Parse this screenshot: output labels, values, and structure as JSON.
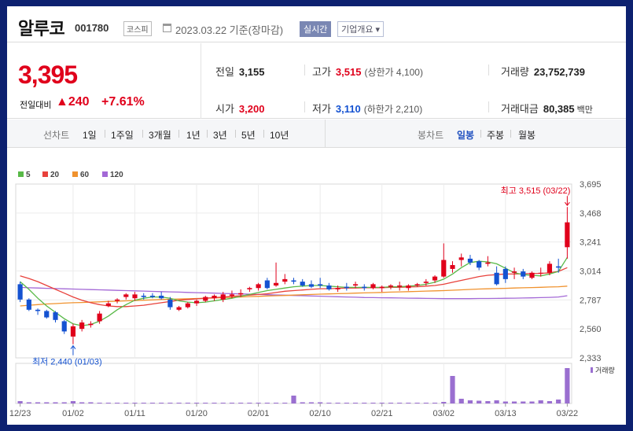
{
  "header": {
    "name": "알루코",
    "code": "001780",
    "market": "코스피",
    "date": "2023.03.22 기준(장마감)",
    "realtime": "실시간",
    "company_info": "기업개요 ▾"
  },
  "quote": {
    "price": "3,395",
    "change_label": "전일대비",
    "change": "▲240",
    "change_pct": "+7.61%",
    "prev_close_label": "전일",
    "prev_close": "3,155",
    "high_label": "고가",
    "high": "3,515",
    "upper_limit": "(상한가 4,100)",
    "volume_label": "거래량",
    "volume": "23,752,739",
    "open_label": "시가",
    "open": "3,200",
    "low_label": "저가",
    "low": "3,110",
    "lower_limit": "(하한가 2,210)",
    "amount_label": "거래대금",
    "amount": "80,385",
    "amount_unit": "백만"
  },
  "period_bar": {
    "line_label": "선차트",
    "line_periods": [
      "1일",
      "1주일",
      "3개월",
      "1년",
      "3년",
      "5년",
      "10년"
    ],
    "candle_label": "봉차트",
    "candle_periods": [
      "일봉",
      "주봉",
      "월봉"
    ],
    "active_candle": "일봉"
  },
  "colors": {
    "up": "#e0001b",
    "down": "#1452d1",
    "ma5": "#58b947",
    "ma20": "#e8413b",
    "ma60": "#f0922e",
    "ma120": "#a368d6",
    "volume": "#9a6fd0"
  },
  "chart_data": {
    "type": "candlestick",
    "legend": [
      {
        "name": "5",
        "color": "#58b947"
      },
      {
        "name": "20",
        "color": "#e8413b"
      },
      {
        "name": "60",
        "color": "#f0922e"
      },
      {
        "name": "120",
        "color": "#a368d6"
      }
    ],
    "y_ticks": [
      "3,695",
      "3,468",
      "3,241",
      "3,014",
      "2,787",
      "2,560",
      "2,333"
    ],
    "ylim": [
      2333,
      3695
    ],
    "x_ticks": [
      "12/23",
      "01/02",
      "01/11",
      "01/20",
      "02/01",
      "02/10",
      "02/21",
      "03/02",
      "03/13",
      "03/22"
    ],
    "x_tick_index": [
      0,
      6,
      13,
      20,
      27,
      34,
      41,
      48,
      55,
      62
    ],
    "high_annotation": "최고 3,515 (03/22)",
    "low_annotation": "최저 2,440 (01/03)",
    "volume_label": "거래량",
    "candles": [
      {
        "o": 2910,
        "h": 2930,
        "l": 2770,
        "c": 2790
      },
      {
        "o": 2790,
        "h": 2800,
        "l": 2700,
        "c": 2710
      },
      {
        "o": 2710,
        "h": 2720,
        "l": 2670,
        "c": 2700
      },
      {
        "o": 2700,
        "h": 2710,
        "l": 2640,
        "c": 2650
      },
      {
        "o": 2690,
        "h": 2700,
        "l": 2610,
        "c": 2630
      },
      {
        "o": 2620,
        "h": 2630,
        "l": 2520,
        "c": 2540
      },
      {
        "o": 2500,
        "h": 2600,
        "l": 2440,
        "c": 2580
      },
      {
        "o": 2560,
        "h": 2630,
        "l": 2540,
        "c": 2610
      },
      {
        "o": 2590,
        "h": 2620,
        "l": 2570,
        "c": 2600
      },
      {
        "o": 2620,
        "h": 2700,
        "l": 2600,
        "c": 2680
      },
      {
        "o": 2740,
        "h": 2780,
        "l": 2730,
        "c": 2760
      },
      {
        "o": 2780,
        "h": 2800,
        "l": 2760,
        "c": 2790
      },
      {
        "o": 2810,
        "h": 2840,
        "l": 2790,
        "c": 2830
      },
      {
        "o": 2800,
        "h": 2850,
        "l": 2780,
        "c": 2830
      },
      {
        "o": 2820,
        "h": 2840,
        "l": 2790,
        "c": 2810
      },
      {
        "o": 2820,
        "h": 2840,
        "l": 2800,
        "c": 2810
      },
      {
        "o": 2820,
        "h": 2850,
        "l": 2790,
        "c": 2800
      },
      {
        "o": 2790,
        "h": 2810,
        "l": 2710,
        "c": 2730
      },
      {
        "o": 2710,
        "h": 2740,
        "l": 2700,
        "c": 2730
      },
      {
        "o": 2730,
        "h": 2770,
        "l": 2720,
        "c": 2760
      },
      {
        "o": 2760,
        "h": 2790,
        "l": 2740,
        "c": 2780
      },
      {
        "o": 2780,
        "h": 2820,
        "l": 2770,
        "c": 2810
      },
      {
        "o": 2800,
        "h": 2830,
        "l": 2780,
        "c": 2820
      },
      {
        "o": 2790,
        "h": 2850,
        "l": 2770,
        "c": 2830
      },
      {
        "o": 2820,
        "h": 2860,
        "l": 2800,
        "c": 2830
      },
      {
        "o": 2830,
        "h": 2870,
        "l": 2810,
        "c": 2840
      },
      {
        "o": 2870,
        "h": 2890,
        "l": 2850,
        "c": 2880
      },
      {
        "o": 2880,
        "h": 2920,
        "l": 2860,
        "c": 2910
      },
      {
        "o": 2940,
        "h": 2960,
        "l": 2870,
        "c": 2880
      },
      {
        "o": 2900,
        "h": 3080,
        "l": 2890,
        "c": 2920
      },
      {
        "o": 2930,
        "h": 2990,
        "l": 2910,
        "c": 2950
      },
      {
        "o": 2940,
        "h": 2960,
        "l": 2910,
        "c": 2930
      },
      {
        "o": 2930,
        "h": 2950,
        "l": 2890,
        "c": 2900
      },
      {
        "o": 2910,
        "h": 2940,
        "l": 2880,
        "c": 2890
      },
      {
        "o": 2910,
        "h": 2960,
        "l": 2880,
        "c": 2900
      },
      {
        "o": 2900,
        "h": 2920,
        "l": 2860,
        "c": 2870
      },
      {
        "o": 2870,
        "h": 2900,
        "l": 2850,
        "c": 2880
      },
      {
        "o": 2890,
        "h": 2920,
        "l": 2860,
        "c": 2880
      },
      {
        "o": 2900,
        "h": 2930,
        "l": 2880,
        "c": 2910
      },
      {
        "o": 2890,
        "h": 2910,
        "l": 2860,
        "c": 2880
      },
      {
        "o": 2880,
        "h": 2920,
        "l": 2870,
        "c": 2910
      },
      {
        "o": 2880,
        "h": 2900,
        "l": 2850,
        "c": 2890
      },
      {
        "o": 2890,
        "h": 2910,
        "l": 2870,
        "c": 2900
      },
      {
        "o": 2890,
        "h": 2930,
        "l": 2860,
        "c": 2900
      },
      {
        "o": 2880,
        "h": 2910,
        "l": 2860,
        "c": 2900
      },
      {
        "o": 2900,
        "h": 2920,
        "l": 2890,
        "c": 2910
      },
      {
        "o": 2920,
        "h": 2950,
        "l": 2900,
        "c": 2930
      },
      {
        "o": 2940,
        "h": 2980,
        "l": 2920,
        "c": 2970
      },
      {
        "o": 2970,
        "h": 3230,
        "l": 2960,
        "c": 3100
      },
      {
        "o": 3030,
        "h": 3090,
        "l": 3000,
        "c": 3060
      },
      {
        "o": 3100,
        "h": 3150,
        "l": 3050,
        "c": 3120
      },
      {
        "o": 3110,
        "h": 3140,
        "l": 3060,
        "c": 3080
      },
      {
        "o": 3090,
        "h": 3100,
        "l": 3020,
        "c": 3040
      },
      {
        "o": 3070,
        "h": 3130,
        "l": 3050,
        "c": 3080
      },
      {
        "o": 3000,
        "h": 3050,
        "l": 2900,
        "c": 2910
      },
      {
        "o": 3030,
        "h": 3050,
        "l": 2920,
        "c": 2950
      },
      {
        "o": 3000,
        "h": 3040,
        "l": 2950,
        "c": 3010
      },
      {
        "o": 3010,
        "h": 3030,
        "l": 2950,
        "c": 2970
      },
      {
        "o": 2960,
        "h": 3010,
        "l": 2950,
        "c": 3000
      },
      {
        "o": 3000,
        "h": 3040,
        "l": 2970,
        "c": 3000
      },
      {
        "o": 3000,
        "h": 3090,
        "l": 2980,
        "c": 3070
      },
      {
        "o": 3050,
        "h": 3110,
        "l": 3000,
        "c": 3040
      },
      {
        "o": 3200,
        "h": 3515,
        "l": 3110,
        "c": 3395
      }
    ],
    "ma5": [
      2930,
      2870,
      2800,
      2740,
      2690,
      2640,
      2600,
      2585,
      2595,
      2620,
      2660,
      2710,
      2750,
      2785,
      2800,
      2810,
      2810,
      2800,
      2780,
      2770,
      2765,
      2770,
      2780,
      2790,
      2800,
      2815,
      2830,
      2845,
      2860,
      2870,
      2880,
      2890,
      2895,
      2900,
      2900,
      2895,
      2890,
      2885,
      2885,
      2885,
      2885,
      2885,
      2890,
      2890,
      2895,
      2900,
      2910,
      2925,
      2950,
      2990,
      3040,
      3080,
      3090,
      3085,
      3070,
      3035,
      3000,
      2985,
      2980,
      2975,
      2990,
      3010,
      3120
    ],
    "ma20": [
      2975,
      2955,
      2930,
      2900,
      2870,
      2840,
      2810,
      2785,
      2765,
      2750,
      2740,
      2735,
      2735,
      2740,
      2745,
      2755,
      2765,
      2775,
      2785,
      2790,
      2795,
      2800,
      2805,
      2810,
      2815,
      2820,
      2825,
      2830,
      2835,
      2845,
      2855,
      2860,
      2865,
      2870,
      2875,
      2875,
      2878,
      2880,
      2880,
      2882,
      2882,
      2883,
      2885,
      2886,
      2888,
      2890,
      2895,
      2900,
      2910,
      2925,
      2940,
      2955,
      2970,
      2980,
      2985,
      2990,
      2990,
      2992,
      2995,
      2995,
      3000,
      3010,
      3040
    ],
    "ma60": [
      2740,
      2745,
      2750,
      2755,
      2758,
      2762,
      2765,
      2767,
      2770,
      2772,
      2775,
      2777,
      2780,
      2782,
      2785,
      2787,
      2790,
      2792,
      2794,
      2796,
      2798,
      2800,
      2802,
      2805,
      2808,
      2810,
      2813,
      2815,
      2818,
      2820,
      2822,
      2825,
      2827,
      2830,
      2832,
      2834,
      2836,
      2838,
      2840,
      2842,
      2844,
      2846,
      2848,
      2850,
      2852,
      2854,
      2856,
      2858,
      2860,
      2863,
      2866,
      2869,
      2872,
      2874,
      2876,
      2878,
      2880,
      2882,
      2884,
      2886,
      2888,
      2890,
      2895
    ],
    "ma120": [
      2885,
      2882,
      2880,
      2878,
      2876,
      2874,
      2872,
      2870,
      2868,
      2866,
      2864,
      2862,
      2860,
      2858,
      2856,
      2854,
      2852,
      2850,
      2848,
      2846,
      2844,
      2842,
      2840,
      2838,
      2836,
      2834,
      2832,
      2830,
      2828,
      2826,
      2824,
      2822,
      2820,
      2818,
      2816,
      2814,
      2812,
      2810,
      2808,
      2806,
      2805,
      2804,
      2803,
      2802,
      2801,
      2800,
      2799,
      2798,
      2797,
      2797,
      2797,
      2797,
      2798,
      2798,
      2799,
      2800,
      2801,
      2802,
      2803,
      2805,
      2807,
      2810,
      2820
    ],
    "volumes": [
      0.6,
      0.3,
      0.3,
      0.3,
      0.3,
      0.3,
      0.6,
      0.3,
      0.3,
      0.2,
      0.2,
      0.2,
      0.2,
      0.2,
      0.2,
      0.2,
      0.2,
      0.2,
      0.2,
      0.2,
      0.2,
      0.2,
      0.2,
      0.2,
      0.2,
      0.2,
      0.2,
      0.2,
      0.2,
      0.2,
      0.2,
      2.0,
      0.3,
      0.3,
      0.3,
      0.2,
      0.2,
      0.2,
      0.2,
      0.2,
      0.2,
      0.2,
      0.2,
      0.2,
      0.2,
      0.2,
      0.2,
      0.2,
      0.4,
      7.0,
      1.2,
      0.8,
      0.7,
      0.6,
      0.8,
      0.5,
      0.5,
      0.5,
      0.5,
      0.8,
      0.6,
      1.0,
      9.0
    ]
  }
}
